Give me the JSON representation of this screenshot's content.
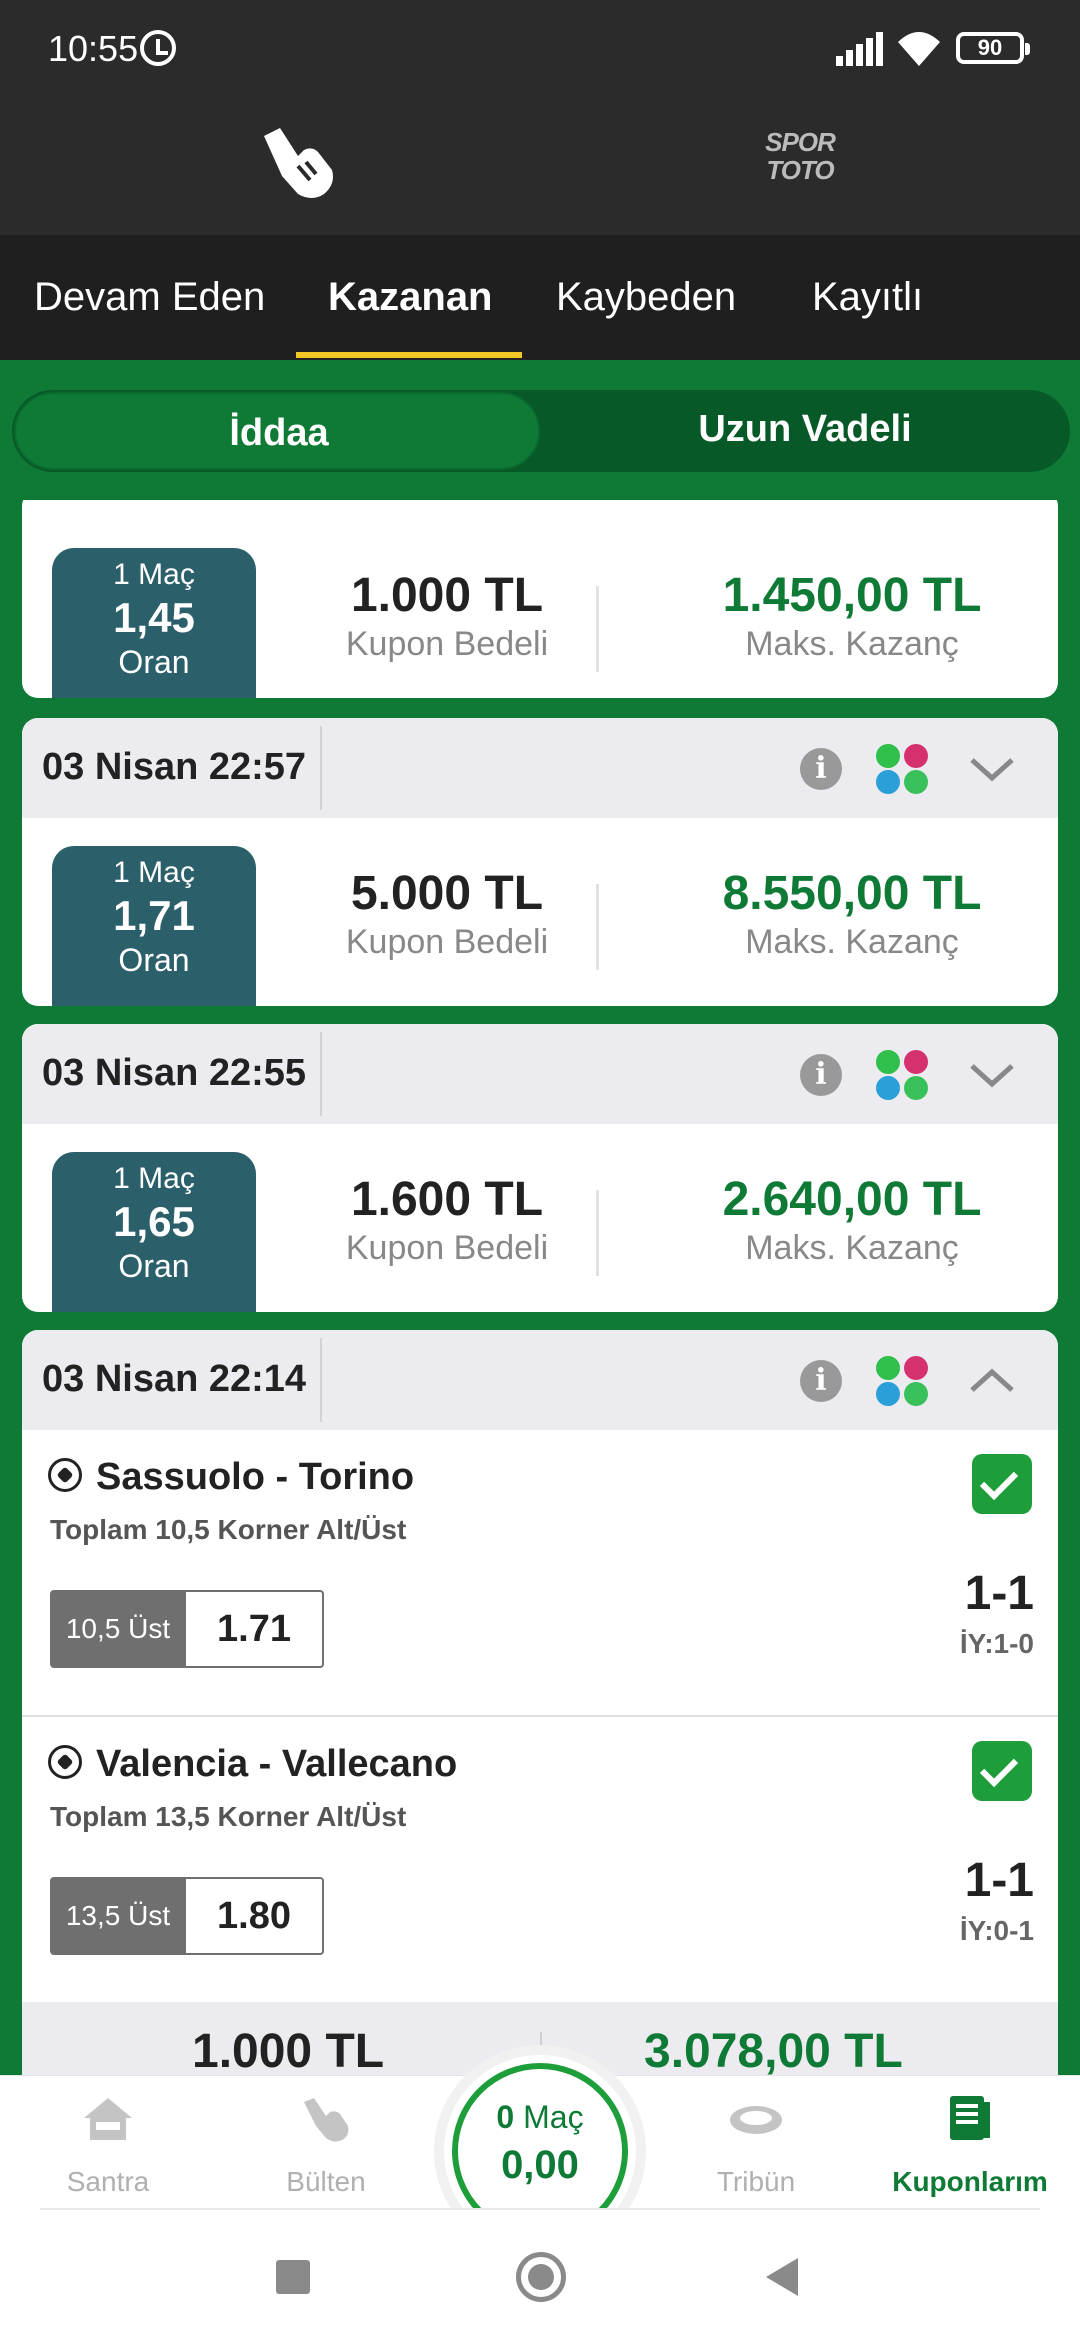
{
  "status_bar": {
    "time": "10:55",
    "battery": "90"
  },
  "header": {
    "brand_right": "SPOR TOTO"
  },
  "tabs": [
    {
      "label": "Devam Eden",
      "active": false
    },
    {
      "label": "Kazanan",
      "active": true
    },
    {
      "label": "Kaybeden",
      "active": false
    },
    {
      "label": "Kayıtlı",
      "active": false
    }
  ],
  "segment": {
    "left": "İddaa",
    "right": "Uzun Vadeli"
  },
  "coupons": [
    {
      "date": "",
      "matches_label": "1 Maç",
      "odds": "1,45",
      "odds_label": "Oran",
      "stake": "1.000 TL",
      "stake_label": "Kupon Bedeli",
      "max_win": "1.450,00 TL",
      "max_win_label": "Maks. Kazanç"
    },
    {
      "date": "03 Nisan 22:57",
      "matches_label": "1 Maç",
      "odds": "1,71",
      "odds_label": "Oran",
      "stake": "5.000 TL",
      "stake_label": "Kupon Bedeli",
      "max_win": "8.550,00 TL",
      "max_win_label": "Maks. Kazanç"
    },
    {
      "date": "03 Nisan 22:55",
      "matches_label": "1 Maç",
      "odds": "1,65",
      "odds_label": "Oran",
      "stake": "1.600 TL",
      "stake_label": "Kupon Bedeli",
      "max_win": "2.640,00 TL",
      "max_win_label": "Maks. Kazanç"
    },
    {
      "date": "03 Nisan 22:14",
      "expanded": true,
      "matches": [
        {
          "teams": "Sassuolo - Torino",
          "market": "Toplam 10,5 Korner Alt/Üst",
          "pick": "10,5 Üst",
          "pick_odds": "1.71",
          "score": "1-1",
          "halftime": "İY:1-0"
        },
        {
          "teams": "Valencia - Vallecano",
          "market": "Toplam 13,5 Korner Alt/Üst",
          "pick": "13,5 Üst",
          "pick_odds": "1.80",
          "score": "1-1",
          "halftime": "İY:0-1"
        }
      ],
      "stake": "1.000 TL",
      "max_win": "3.078,00 TL"
    }
  ],
  "bottom_nav": {
    "items": [
      {
        "label": "Santra",
        "icon": "home-icon"
      },
      {
        "label": "Bülten",
        "icon": "hand-icon"
      },
      {
        "label": "Tribün",
        "icon": "stadium-icon"
      },
      {
        "label": "Kuponlarım",
        "icon": "coupons-icon",
        "active": true
      }
    ],
    "cart": {
      "count": "0",
      "count_label": "Maç",
      "total": "0,00"
    }
  },
  "colors": {
    "brand_green": "#0e7a36",
    "tab_underline": "#f2c624",
    "odds_box": "#2b5f6a"
  }
}
